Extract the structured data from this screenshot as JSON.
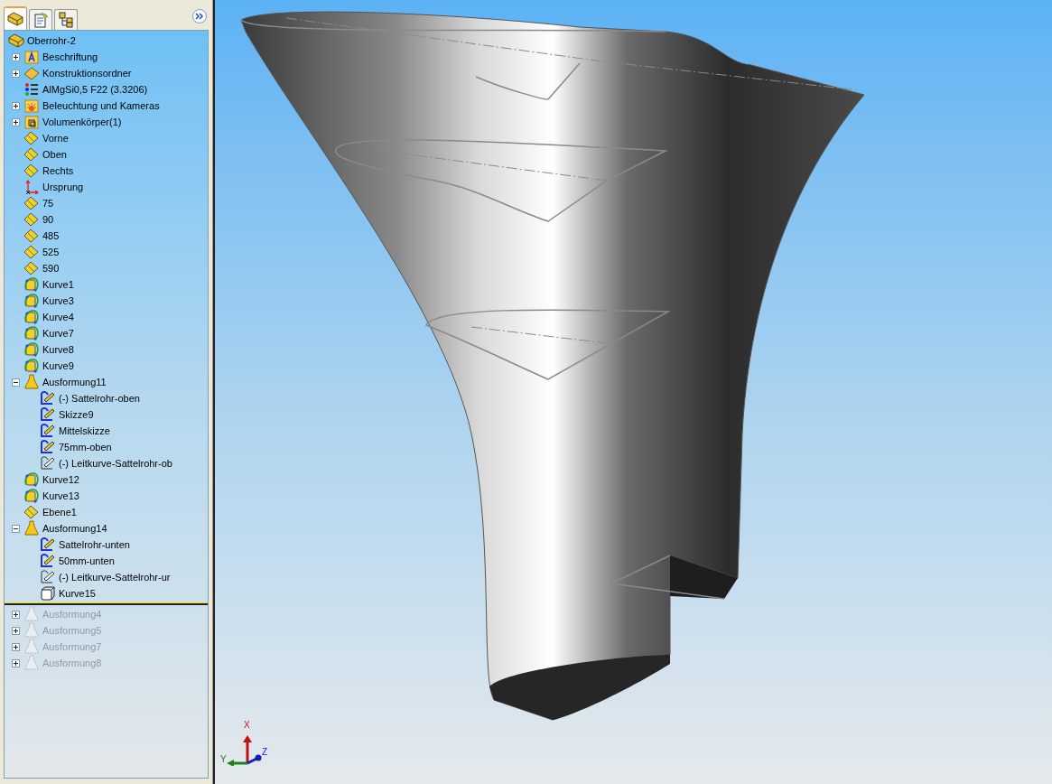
{
  "panel_tabs": [
    {
      "kind": "feature-manager",
      "selected": true
    },
    {
      "kind": "property-manager",
      "selected": false
    },
    {
      "kind": "configuration-manager",
      "selected": false
    }
  ],
  "tree": {
    "root": {
      "label": "Oberrohr-2",
      "kind": "part"
    },
    "items": [
      {
        "label": "Beschriftung",
        "kind": "annotations",
        "expanded": false,
        "rolled_back": false
      },
      {
        "label": "Konstruktionsordner",
        "kind": "design-folder",
        "expanded": false,
        "rolled_back": false
      },
      {
        "label": "AlMgSi0,5 F22 (3.3206)",
        "kind": "material",
        "rolled_back": false
      },
      {
        "label": "Beleuchtung und Kameras",
        "kind": "lights",
        "expanded": false,
        "rolled_back": false
      },
      {
        "label": "Volumenkörper(1)",
        "kind": "solids",
        "expanded": false,
        "rolled_back": false
      },
      {
        "label": "Vorne",
        "kind": "plane",
        "rolled_back": false
      },
      {
        "label": "Oben",
        "kind": "plane",
        "rolled_back": false
      },
      {
        "label": "Rechts",
        "kind": "plane",
        "rolled_back": false
      },
      {
        "label": "Ursprung",
        "kind": "origin",
        "rolled_back": false
      },
      {
        "label": "75",
        "kind": "plane",
        "rolled_back": false
      },
      {
        "label": "90",
        "kind": "plane",
        "rolled_back": false
      },
      {
        "label": "485",
        "kind": "plane",
        "rolled_back": false
      },
      {
        "label": "525",
        "kind": "plane",
        "rolled_back": false
      },
      {
        "label": "590",
        "kind": "plane",
        "rolled_back": false
      },
      {
        "label": "Kurve1",
        "kind": "curve",
        "rolled_back": false
      },
      {
        "label": "Kurve3",
        "kind": "curve",
        "rolled_back": false
      },
      {
        "label": "Kurve4",
        "kind": "curve",
        "rolled_back": false
      },
      {
        "label": "Kurve7",
        "kind": "curve",
        "rolled_back": false
      },
      {
        "label": "Kurve8",
        "kind": "curve",
        "rolled_back": false
      },
      {
        "label": "Kurve9",
        "kind": "curve",
        "rolled_back": false
      },
      {
        "label": "Ausformung11",
        "kind": "loft",
        "expanded": true,
        "rolled_back": false,
        "children": [
          {
            "label": "(-) Sattelrohr-oben",
            "kind": "sketch"
          },
          {
            "label": "Skizze9",
            "kind": "sketch"
          },
          {
            "label": "Mittelskizze",
            "kind": "sketch"
          },
          {
            "label": "75mm-oben",
            "kind": "sketch"
          },
          {
            "label": "(-) Leitkurve-Sattelrohr-ob",
            "kind": "guide-sketch"
          }
        ]
      },
      {
        "label": "Kurve12",
        "kind": "curve",
        "rolled_back": false
      },
      {
        "label": "Kurve13",
        "kind": "curve",
        "rolled_back": false
      },
      {
        "label": "Ebene1",
        "kind": "plane",
        "rolled_back": false
      },
      {
        "label": "Ausformung14",
        "kind": "loft",
        "expanded": true,
        "rolled_back": false,
        "children": [
          {
            "label": "Sattelrohr-unten",
            "kind": "sketch"
          },
          {
            "label": "50mm-unten",
            "kind": "sketch"
          },
          {
            "label": "(-) Leitkurve-Sattelrohr-ur",
            "kind": "guide-sketch"
          },
          {
            "label": "Kurve15",
            "kind": "composite-curve"
          }
        ]
      },
      {
        "label": "Ausformung4",
        "kind": "loft",
        "expanded": false,
        "rolled_back": true
      },
      {
        "label": "Ausformung5",
        "kind": "loft",
        "expanded": false,
        "rolled_back": true
      },
      {
        "label": "Ausformung7",
        "kind": "loft",
        "expanded": false,
        "rolled_back": true
      },
      {
        "label": "Ausformung8",
        "kind": "loft",
        "expanded": false,
        "rolled_back": true
      }
    ]
  },
  "triad": {
    "x": "X",
    "y": "Y",
    "z": "Z"
  }
}
